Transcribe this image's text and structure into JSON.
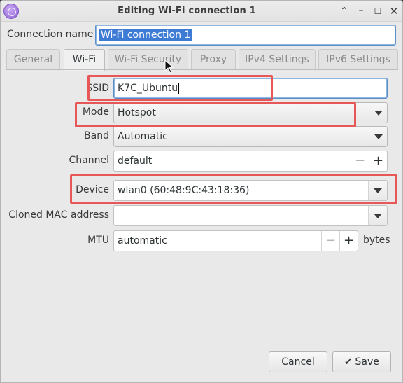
{
  "window": {
    "title": "Editing Wi-Fi connection 1"
  },
  "connection": {
    "label": "Connection name",
    "value": "Wi-Fi connection 1"
  },
  "tabs": [
    {
      "label": "General",
      "active": false
    },
    {
      "label": "Wi-Fi",
      "active": true
    },
    {
      "label": "Wi-Fi Security",
      "active": false
    },
    {
      "label": "Proxy",
      "active": false
    },
    {
      "label": "IPv4 Settings",
      "active": false
    },
    {
      "label": "IPv6 Settings",
      "active": false
    }
  ],
  "form": {
    "ssid": {
      "label": "SSID",
      "value": "K7C_Ubuntu"
    },
    "mode": {
      "label": "Mode",
      "value": "Hotspot"
    },
    "band": {
      "label": "Band",
      "value": "Automatic"
    },
    "channel": {
      "label": "Channel",
      "value": "default"
    },
    "device": {
      "label": "Device",
      "value": "wlan0 (60:48:9C:43:18:36)"
    },
    "cloned_mac": {
      "label": "Cloned MAC address",
      "value": ""
    },
    "mtu": {
      "label": "MTU",
      "value": "automatic",
      "unit": "bytes"
    }
  },
  "buttons": {
    "cancel": "Cancel",
    "save": "Save"
  },
  "highlight_color": "#e85757",
  "accent_color": "#3d7bd5"
}
